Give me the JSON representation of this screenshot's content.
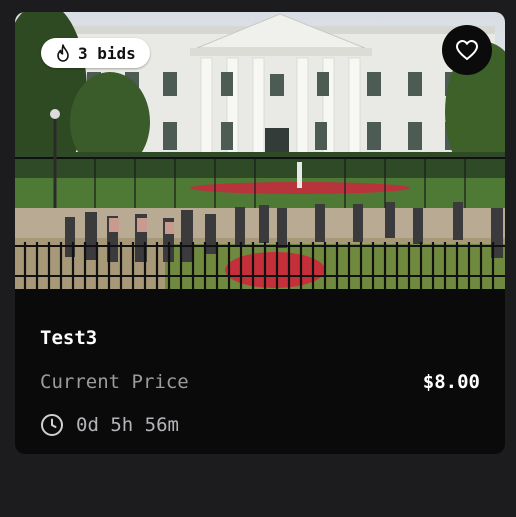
{
  "listing": {
    "bids_label": "3 bids",
    "title": "Test3",
    "price_label": "Current Price",
    "price_value": "$8.00",
    "time_remaining": "0d 5h 56m"
  },
  "icons": {
    "bids": "flame-icon",
    "favorite": "heart-icon",
    "timer": "clock-icon"
  },
  "colors": {
    "page_background": "#1c1c1e",
    "card_background": "#0a0a0b",
    "pill_background": "#ffffff",
    "muted_text": "#9b9b9f"
  }
}
